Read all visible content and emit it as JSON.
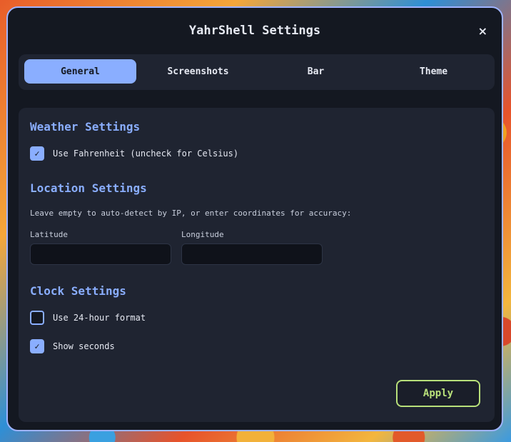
{
  "window": {
    "title": "YahrShell Settings",
    "close_icon": "×"
  },
  "tabs": [
    {
      "label": "General",
      "active": true
    },
    {
      "label": "Screenshots",
      "active": false
    },
    {
      "label": "Bar",
      "active": false
    },
    {
      "label": "Theme",
      "active": false
    }
  ],
  "weather": {
    "heading": "Weather Settings",
    "fahrenheit_label": "Use Fahrenheit (uncheck for Celsius)",
    "fahrenheit_checked": true
  },
  "location": {
    "heading": "Location Settings",
    "note": "Leave empty to auto-detect by IP, or enter coordinates for accuracy:",
    "latitude_label": "Latitude",
    "latitude_value": "",
    "longitude_label": "Longitude",
    "longitude_value": ""
  },
  "clock": {
    "heading": "Clock Settings",
    "h24_label": "Use 24-hour format",
    "h24_checked": false,
    "seconds_label": "Show seconds",
    "seconds_checked": true
  },
  "apply_label": "Apply",
  "checkmark_glyph": "✓",
  "colors": {
    "accent": "#8aaeff",
    "apply_accent": "#b8e07a",
    "window_bg": "#141821",
    "panel_bg": "#1f2431"
  }
}
